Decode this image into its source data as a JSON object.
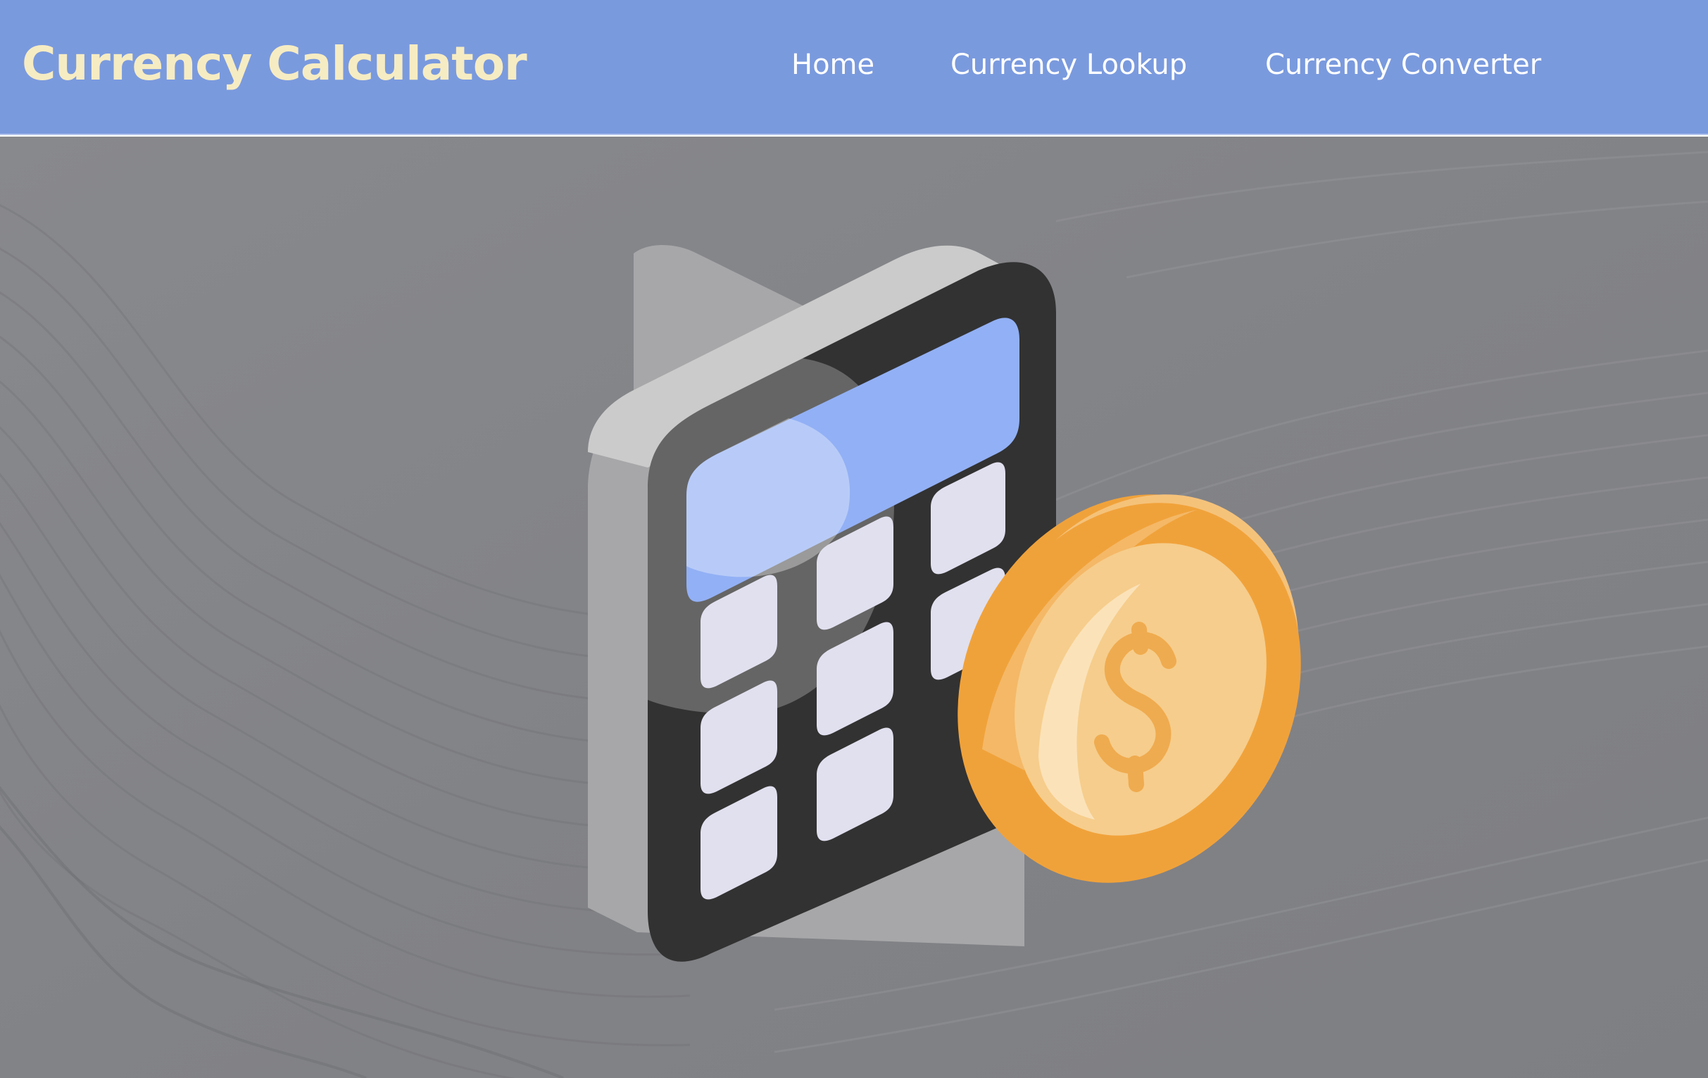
{
  "header": {
    "brand": "Currency Calculator",
    "nav": [
      {
        "label": "Home"
      },
      {
        "label": "Currency Lookup"
      },
      {
        "label": "Currency Converter"
      }
    ]
  },
  "hero": {
    "illustration_icons": [
      "calculator-icon",
      "dollar-coin-icon"
    ],
    "coin_symbol": "$"
  },
  "colors": {
    "navbar": "#7a9ade",
    "brand_text": "#f6ecc3",
    "nav_text": "#ffffff",
    "hero_background": "#848589",
    "calculator_body": "#333333",
    "calculator_screen": "#92b0f5",
    "calculator_keys": "#e1e0ef",
    "coin": "#f0a23a"
  }
}
